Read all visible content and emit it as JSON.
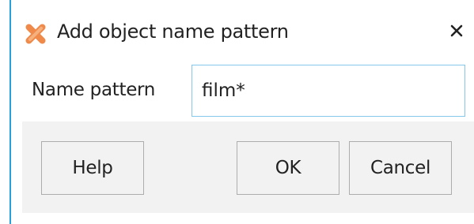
{
  "dialog": {
    "title": "Add object name pattern",
    "icon": "orange-x-app-icon",
    "close_icon": "close-icon"
  },
  "form": {
    "name_pattern_label": "Name pattern",
    "name_pattern_value": "film*"
  },
  "buttons": {
    "help_label": "Help",
    "ok_label": "OK",
    "cancel_label": "Cancel"
  },
  "colors": {
    "accent_border": "#29a0de",
    "input_focus_border": "#86c8ec",
    "icon_orange": "#f08a4b",
    "button_panel_bg": "#f2f2f2"
  }
}
